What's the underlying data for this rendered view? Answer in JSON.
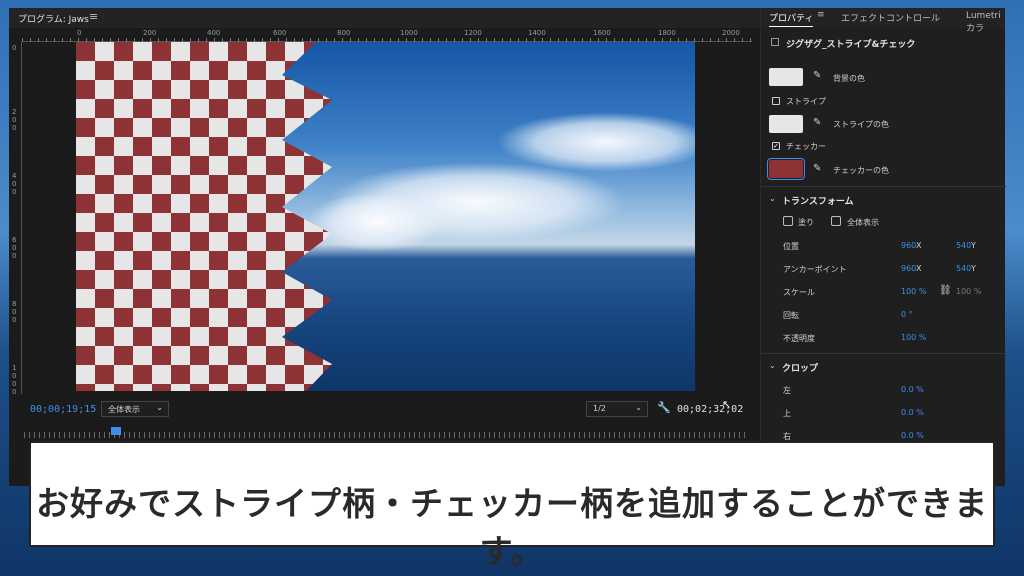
{
  "program_monitor": {
    "title": "プログラム: Jaws",
    "menu_icon": "hamburger-menu-icon",
    "ruler_top": [
      "0",
      "200",
      "400",
      "600",
      "800",
      "1000",
      "1200",
      "1400",
      "1600",
      "1800",
      "2000"
    ],
    "ruler_left": [
      "0",
      "200",
      "400",
      "600",
      "800",
      "1000"
    ],
    "timecode_current": "00;00;19;15",
    "fit_select": "全体表示",
    "resolution_select": "1/2",
    "timecode_duration": "00;02;32;02",
    "settings_icon": "wrench-icon"
  },
  "properties_panel": {
    "tabs": [
      "プロパティ",
      "エフェクトコントロール",
      "Lumetri カラ"
    ],
    "effect_name": "ジグザグ_ストライプ&チェック",
    "background_color_label": "背景の色",
    "stripe_label": "ストライプ",
    "stripe_checked": false,
    "stripe_color_label": "ストライプの色",
    "checker_label": "チェッカー",
    "checker_checked": true,
    "checker_color_label": "チェッカーの色",
    "colors": {
      "background": "#e6e6e6",
      "stripe": "#e6e6e6",
      "checker": "#8e3335",
      "accent": "#3d8ee8"
    },
    "transform": {
      "title": "トランスフォーム",
      "fill_label": "塗り",
      "fit_label": "全体表示",
      "position_label": "位置",
      "position_x": "960",
      "position_y": "540",
      "anchor_label": "アンカーポイント",
      "anchor_x": "960",
      "anchor_y": "540",
      "scale_label": "スケール",
      "scale_value": "100 %",
      "scale_value_linked": "100 %",
      "rotation_label": "回転",
      "rotation_value": "0 °",
      "opacity_label": "不透明度",
      "opacity_value": "100 %",
      "axis_x": "X",
      "axis_y": "Y"
    },
    "crop": {
      "title": "クロップ",
      "left_label": "左",
      "left_value": "0.0 %",
      "top_label": "上",
      "top_value": "0.0 %",
      "right_label": "右",
      "right_value": "0.0 %"
    }
  },
  "subtitle": "お好みでストライプ柄・チェッカー柄を追加することができます。"
}
